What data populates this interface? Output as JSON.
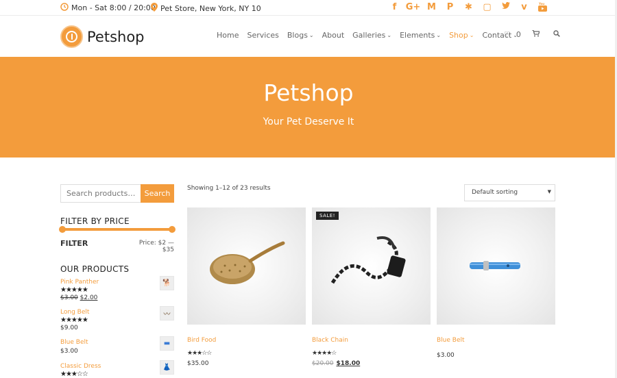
{
  "topbar": {
    "hours": "Mon - Sat 8:00 / 20:00",
    "location": "Pet Store, New York, NY 10",
    "social_icons": [
      "facebook-icon",
      "google-plus-icon",
      "gmail-icon",
      "paypal-icon",
      "slack-icon",
      "twitch-icon",
      "twitter-icon",
      "vimeo-icon",
      "youtube-icon"
    ],
    "social_glyphs": [
      "f",
      "G+",
      "M",
      "P",
      "✱",
      "▢",
      "🐦",
      "v",
      "▶"
    ]
  },
  "header": {
    "logo_text": "Petshop",
    "nav": [
      {
        "label": "Home",
        "caret": false
      },
      {
        "label": "Services",
        "caret": false
      },
      {
        "label": "Blogs",
        "caret": true
      },
      {
        "label": "About",
        "caret": false
      },
      {
        "label": "Galleries",
        "caret": true
      },
      {
        "label": "Elements",
        "caret": true
      },
      {
        "label": "Shop",
        "caret": true,
        "active": true
      },
      {
        "label": "Contact",
        "caret": true
      }
    ],
    "wishlist_count": "0"
  },
  "hero": {
    "title": "Petshop",
    "subtitle": "Your Pet Deserve It"
  },
  "sidebar": {
    "search_placeholder": "Search products…",
    "search_button": "Search",
    "filter_title": "FILTER BY PRICE",
    "filter_button": "FILTER",
    "price_range": "Price: $2 — $35",
    "products_title": "OUR PRODUCTS",
    "products": [
      {
        "name": "Pink Panther",
        "rating": 4.5,
        "old_price": "$3.00",
        "price": "$2.00"
      },
      {
        "name": "Long Belt",
        "rating": 5,
        "old_price": "",
        "price": "$9.00"
      },
      {
        "name": "Blue Belt",
        "rating": 0,
        "old_price": "",
        "price": "$3.00"
      },
      {
        "name": "Classic Dress",
        "rating": 3,
        "old_price": "",
        "price": ""
      }
    ]
  },
  "main": {
    "results_text": "Showing 1–12 of 23 results",
    "sort_selected": "Default sorting",
    "sale_badge": "SALE!",
    "cards": [
      {
        "name": "Bird Food",
        "rating": 3,
        "old_price": "",
        "price": "$35.00"
      },
      {
        "name": "Black Chain",
        "rating": 4,
        "old_price": "$20.00",
        "price": "$18.00"
      },
      {
        "name": "Blue Belt",
        "rating": 0,
        "old_price": "",
        "price": "$3.00"
      }
    ]
  },
  "colors": {
    "accent": "#f39c3c"
  }
}
